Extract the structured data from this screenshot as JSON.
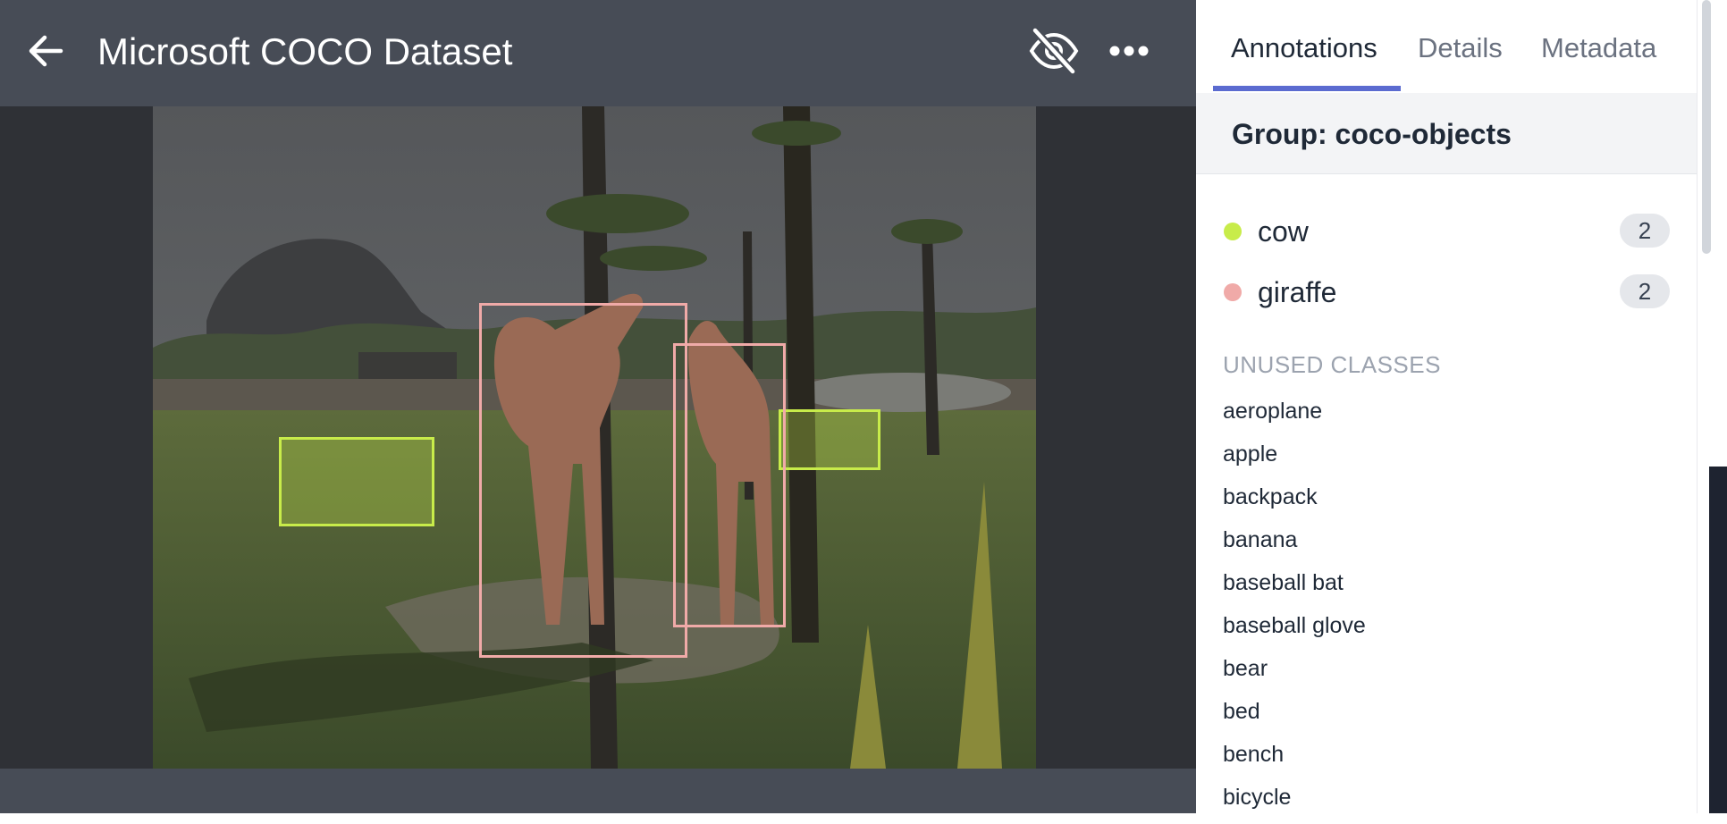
{
  "header": {
    "title": "Microsoft COCO Dataset",
    "back_icon": "arrow-left-icon",
    "hide_icon": "eye-off-icon",
    "more_icon": "more-horizontal-icon"
  },
  "tabs": [
    {
      "label": "Annotations",
      "active": true
    },
    {
      "label": "Details",
      "active": false
    },
    {
      "label": "Metadata",
      "active": false
    }
  ],
  "group": {
    "title": "Group: coco-objects"
  },
  "classes": [
    {
      "name": "cow",
      "count": "2",
      "color": "#c8ec4a"
    },
    {
      "name": "giraffe",
      "count": "2",
      "color": "#f0aaa8"
    }
  ],
  "unused": {
    "title": "UNUSED CLASSES",
    "items": [
      "aeroplane",
      "apple",
      "backpack",
      "banana",
      "baseball bat",
      "baseball glove",
      "bear",
      "bed",
      "bench",
      "bicycle"
    ]
  },
  "colors": {
    "accent": "#5b6bd0",
    "cow": "#c8ec4a",
    "giraffe": "#f0aaa8",
    "topbar": "#474c56",
    "viewer_bg": "#2f3136"
  }
}
